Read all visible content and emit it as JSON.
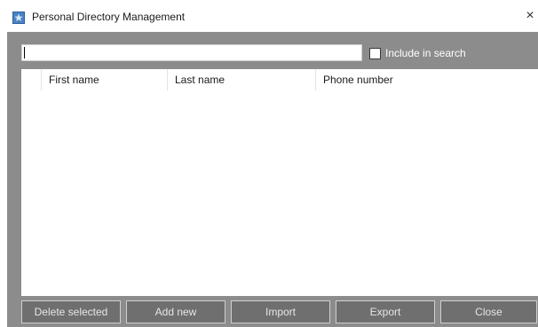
{
  "window": {
    "title": "Personal Directory Management",
    "app_icon": "star-icon",
    "close_glyph": "×"
  },
  "search": {
    "value": "",
    "placeholder": ""
  },
  "include_in_search": {
    "label": "Include in search",
    "checked": false
  },
  "table": {
    "columns": [
      "First name",
      "Last name",
      "Phone number"
    ],
    "rows": []
  },
  "buttons": {
    "delete_selected": "Delete selected",
    "add_new": "Add new",
    "import": "Import",
    "export": "Export",
    "close": "Close"
  },
  "colors": {
    "body_background": "#8c8c8c",
    "button_background": "#6f6f6f",
    "app_icon": "#4a83c4"
  }
}
